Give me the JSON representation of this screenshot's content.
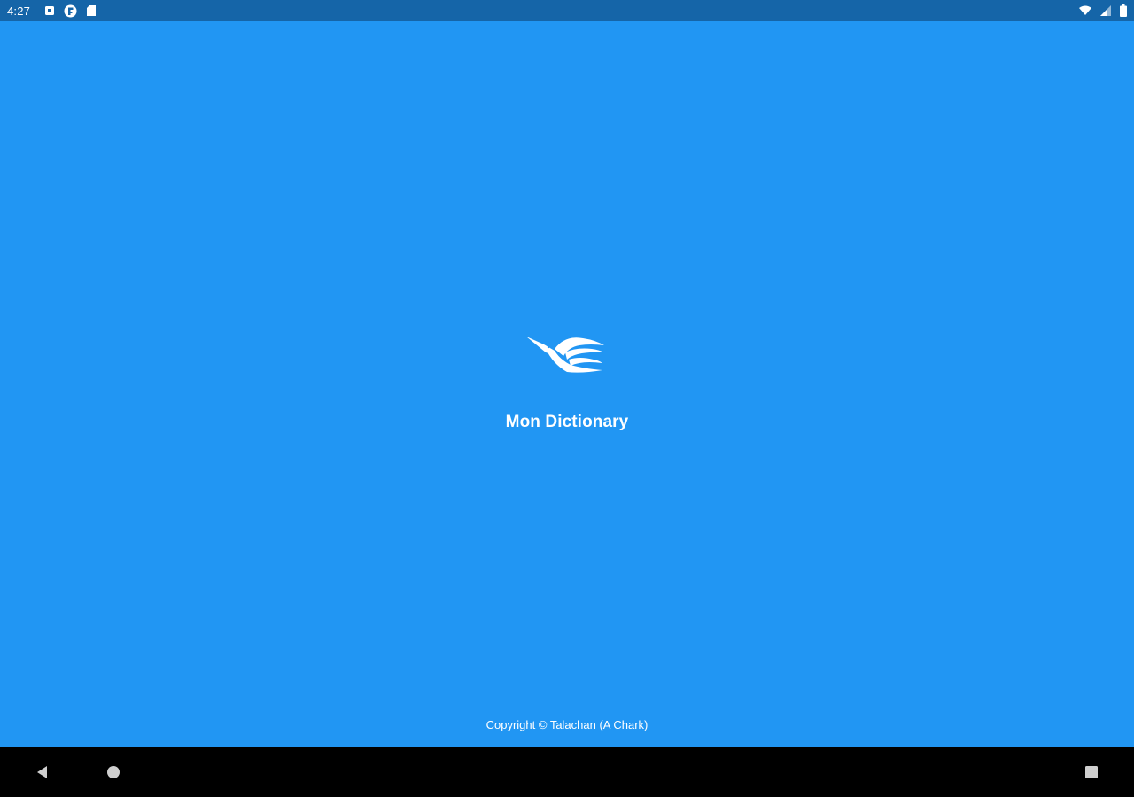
{
  "status_bar": {
    "time": "4:27",
    "left_icons": [
      "notification-square-icon",
      "flipboard-icon",
      "sd-card-icon"
    ],
    "right_icons": [
      "wifi-icon",
      "signal-icon",
      "battery-icon"
    ]
  },
  "splash": {
    "logo_icon": "bird-logo-icon",
    "title": "Mon Dictionary",
    "copyright": "Copyright © Talachan (A Chark)"
  },
  "nav_bar": {
    "buttons": [
      "back-icon",
      "home-icon",
      "recents-icon"
    ]
  },
  "colors": {
    "background": "#2196F3",
    "status_bar": "#1565A8",
    "nav_bar": "#000000",
    "foreground": "#FFFFFF"
  }
}
